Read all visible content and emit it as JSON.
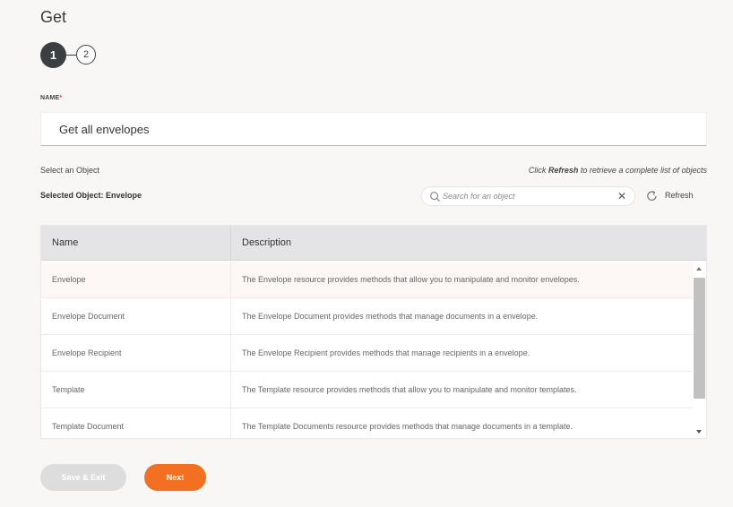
{
  "page": {
    "title": "Get"
  },
  "steps": {
    "current": "1",
    "next": "2"
  },
  "name_field": {
    "label": "NAME",
    "required_mark": "*",
    "value": "Get all envelopes"
  },
  "object_section": {
    "select_label": "Select an Object",
    "hint_prefix": "Click ",
    "hint_bold": "Refresh",
    "hint_suffix": " to retrieve a complete list of objects",
    "selected_label": "Selected Object: Envelope",
    "search_placeholder": "Search for an object",
    "refresh_label": "Refresh"
  },
  "table": {
    "headers": {
      "name": "Name",
      "description": "Description"
    },
    "rows": [
      {
        "name": "Envelope",
        "description": "The Envelope resource provides methods that allow you to manipulate and monitor envelopes."
      },
      {
        "name": "Envelope Document",
        "description": "The Envelope Document provides methods that manage documents in a envelope."
      },
      {
        "name": "Envelope Recipient",
        "description": "The Envelope Recipient provides methods that manage recipients in a envelope."
      },
      {
        "name": "Template",
        "description": "The Template resource provides methods that allow you to manipulate and monitor templates."
      },
      {
        "name": "Template Document",
        "description": "The Template Documents resource provides methods that manage documents in a template."
      }
    ]
  },
  "buttons": {
    "save_exit": "Save & Exit",
    "next": "Next"
  },
  "colors": {
    "accent": "#f36f21",
    "step_active": "#3c3f42",
    "required": "#e8462e",
    "selected_row": "#fdf7f5"
  }
}
